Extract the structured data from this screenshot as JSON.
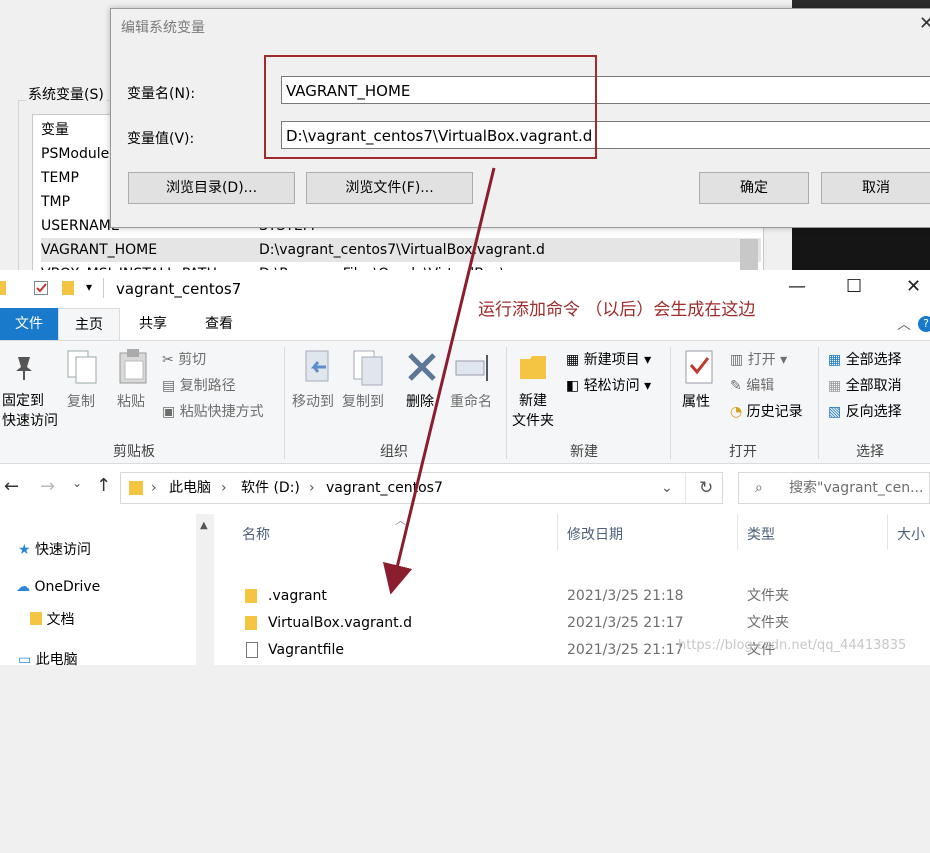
{
  "sys_props": {
    "system_vars_label": "系统变量(S)",
    "rows": [
      {
        "name": "变量",
        "value": ""
      },
      {
        "name": "PSModule",
        "value": ""
      },
      {
        "name": "TEMP",
        "value": ""
      },
      {
        "name": "TMP",
        "value": ""
      },
      {
        "name": "USERNAME",
        "value": "SYSTEM"
      },
      {
        "name": "VAGRANT_HOME",
        "value": "D:\\vagrant_centos7\\VirtualBox.vagrant.d"
      },
      {
        "name": "VBOX_MSI_INSTALL_PATH",
        "value": "D:\\Program Files\\Oracle\\VirtualBox\\"
      }
    ]
  },
  "edit_dialog": {
    "title": "编辑系统变量",
    "close": "✕",
    "name_label": "变量名(N):",
    "name_value": "VAGRANT_HOME",
    "value_label": "变量值(V):",
    "value_value": "D:\\vagrant_centos7\\VirtualBox.vagrant.d",
    "browse_dir": "浏览目录(D)...",
    "browse_file": "浏览文件(F)...",
    "ok": "确定",
    "cancel": "取消"
  },
  "annotation": "运行添加命令 （以后）会生成在这边",
  "explorer": {
    "title": "vagrant_centos7",
    "qat_dropdown": "▾",
    "controls": {
      "minimize": "—",
      "maximize": "☐",
      "close": "✕"
    },
    "tabs": {
      "file": "文件",
      "home": "主页",
      "share": "共享",
      "view": "查看"
    },
    "collapse": "︿",
    "help": "?",
    "ribbon": {
      "pin": "固定到\n快速访问",
      "copy": "复制",
      "paste": "粘贴",
      "cut": "剪切",
      "copy_path": "复制路径",
      "paste_shortcut": "粘贴快捷方式",
      "clipboard_group": "剪贴板",
      "move_to": "移动到",
      "copy_to": "复制到",
      "delete": "删除",
      "rename": "重命名",
      "organize_group": "组织",
      "new_folder": "新建\n文件夹",
      "new_item": "新建项目",
      "easy_access": "轻松访问",
      "new_group": "新建",
      "properties": "属性",
      "open": "打开",
      "edit": "编辑",
      "history": "历史记录",
      "open_group": "打开",
      "select_all": "全部选择",
      "select_none": "全部取消",
      "invert": "反向选择",
      "select_group": "选择"
    },
    "address": {
      "crumbs": [
        "此电脑",
        "软件 (D:)",
        "vagrant_centos7"
      ],
      "search_placeholder": "搜索\"vagrant_cen..."
    },
    "nav": {
      "quick_access": "快速访问",
      "onedrive": "OneDrive",
      "documents": "文档",
      "this_pc": "此电脑"
    },
    "columns": {
      "name": "名称",
      "date": "修改日期",
      "type": "类型",
      "size": "大小"
    },
    "files": [
      {
        "name": ".vagrant",
        "date": "2021/3/25 21:18",
        "type": "文件夹",
        "kind": "folder"
      },
      {
        "name": "VirtualBox.vagrant.d",
        "date": "2021/3/25 21:17",
        "type": "文件夹",
        "kind": "folder"
      },
      {
        "name": "Vagrantfile",
        "date": "2021/3/25 21:17",
        "type": "文件",
        "kind": "file"
      }
    ]
  },
  "watermark": "https://blog.csdn.net/qq_44413835",
  "colors": {
    "accent": "#1979ca",
    "annotation": "#a02b2b",
    "folder": "#f4c542"
  }
}
